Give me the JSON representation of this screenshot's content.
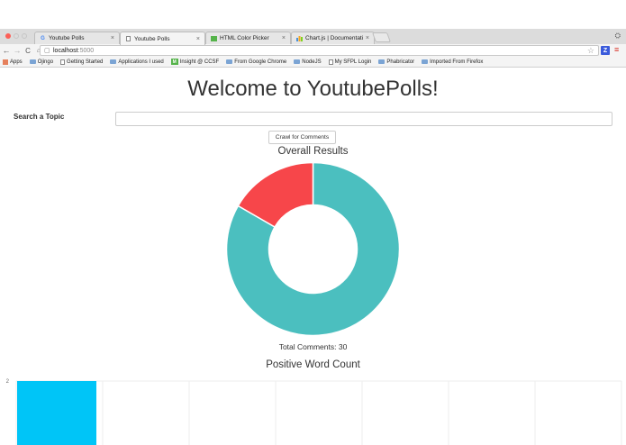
{
  "browser": {
    "tabs": [
      {
        "label": "Youtube Polls",
        "favicon": "G",
        "active": false
      },
      {
        "label": "Youtube Polls",
        "favicon": "",
        "active": true
      },
      {
        "label": "HTML Color Picker",
        "favicon": "html",
        "active": false
      },
      {
        "label": "Chart.js | Documentation",
        "favicon": "bar",
        "active": false
      }
    ],
    "url_host": "localhost",
    "url_port": ":5000",
    "bookmarks": [
      {
        "label": "Apps",
        "type": "apps"
      },
      {
        "label": "Ojingo",
        "type": "folder"
      },
      {
        "label": "Getting Started",
        "type": "doc"
      },
      {
        "label": "Applications I used",
        "type": "folder"
      },
      {
        "label": "Insight @ CCSF",
        "type": "m"
      },
      {
        "label": "From Google Chrome",
        "type": "folder"
      },
      {
        "label": "NodeJS",
        "type": "folder"
      },
      {
        "label": "My SFPL Login",
        "type": "doc"
      },
      {
        "label": "Phabricator",
        "type": "folder"
      },
      {
        "label": "Imported From Firefox",
        "type": "folder"
      }
    ]
  },
  "page": {
    "title": "Welcome to YoutubePolls!",
    "search_label": "Search a Topic",
    "crawl_button": "Crawl for Comments",
    "total_comments": "Total Comments: 30"
  },
  "chart_data": [
    {
      "type": "pie",
      "title": "Overall Results",
      "values": [
        25,
        5
      ],
      "colors": [
        "#4bbfbf",
        "#f7464a"
      ],
      "donut": true
    },
    {
      "type": "bar",
      "title": "Positive Word Count",
      "ytick_labels": [
        "2"
      ],
      "values": [
        2,
        0,
        0,
        0,
        0,
        0,
        0
      ],
      "ylim": [
        0,
        2
      ],
      "color": "#00c5f7",
      "grid": true
    }
  ]
}
